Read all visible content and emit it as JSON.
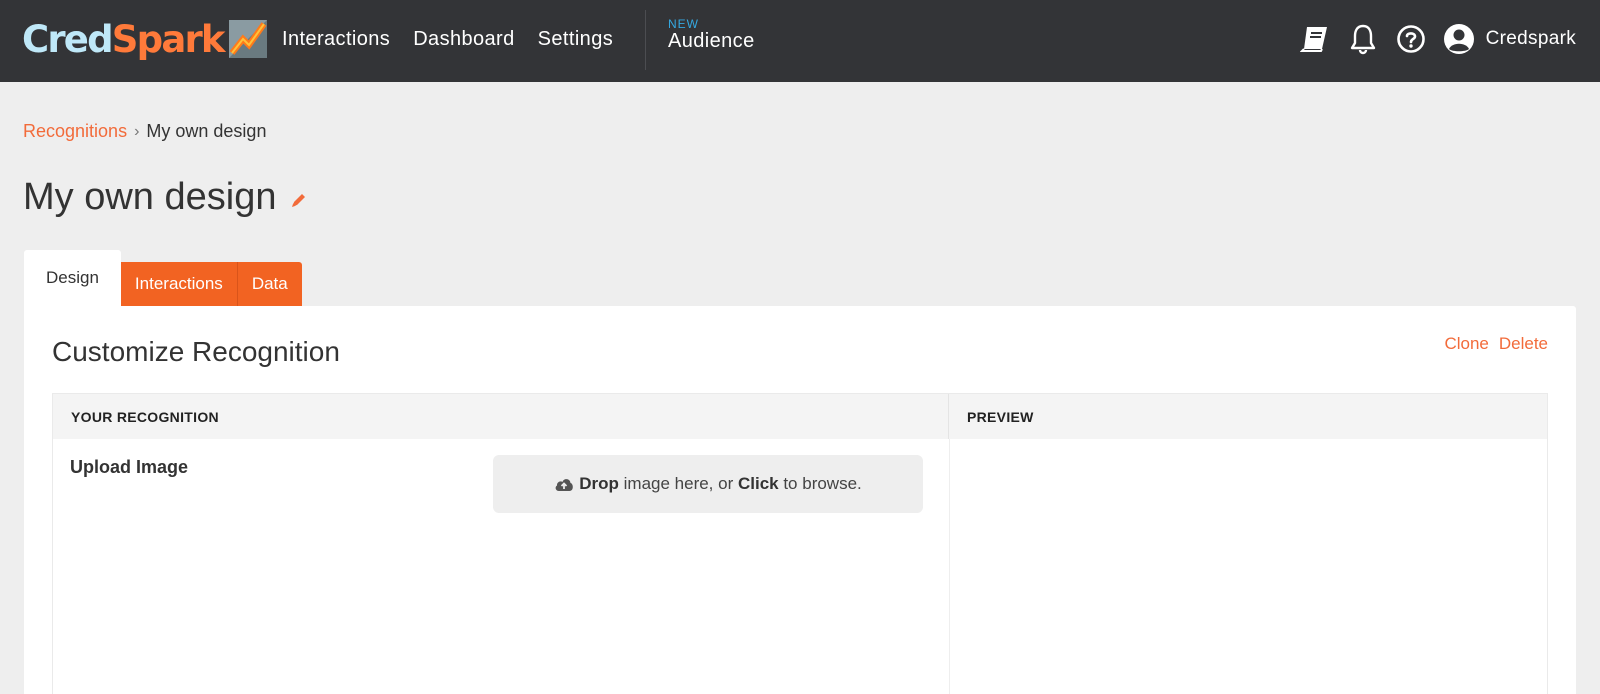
{
  "brand": {
    "part1": "Cred",
    "part2": "Spark",
    "accent": "#f26322",
    "header_bg": "#333437"
  },
  "nav": {
    "items": [
      "Interactions",
      "Dashboard",
      "Settings"
    ],
    "new_badge": "NEW",
    "audience": "Audience"
  },
  "header_right": {
    "icons": [
      "book-icon",
      "bell-icon",
      "help-icon",
      "user-icon"
    ],
    "user_name": "Credspark"
  },
  "breadcrumb": {
    "parent": "Recognitions",
    "separator": "›",
    "current": "My own design"
  },
  "page": {
    "title": "My own design"
  },
  "tabs": [
    {
      "label": "Design",
      "active": true
    },
    {
      "label": "Interactions",
      "active": false
    },
    {
      "label": "Data",
      "active": false
    }
  ],
  "panel": {
    "title": "Customize Recognition",
    "actions": {
      "clone": "Clone",
      "delete": "Delete"
    },
    "columns": {
      "left": "YOUR RECOGNITION",
      "right": "PREVIEW"
    },
    "upload": {
      "label": "Upload Image",
      "drop_bold": "Drop",
      "drop_mid": " image here, or ",
      "click_bold": "Click",
      "drop_end": " to browse."
    }
  }
}
